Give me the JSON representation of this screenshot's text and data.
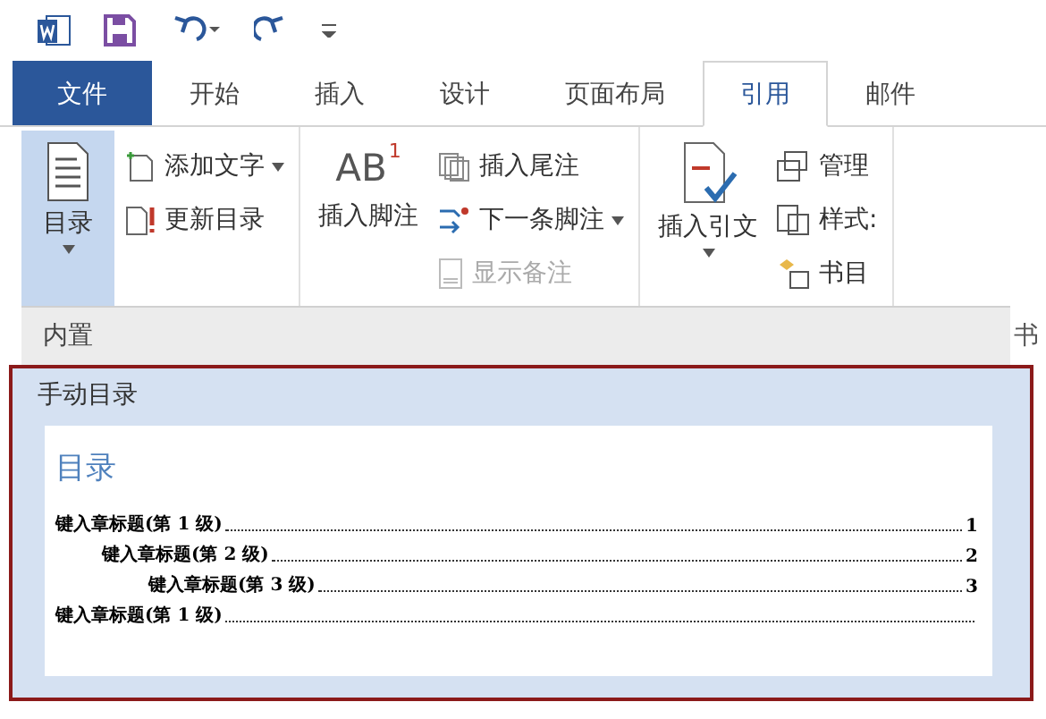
{
  "tabs": [
    {
      "label": "文件",
      "kind": "file",
      "selected": false
    },
    {
      "label": "开始",
      "kind": "tab",
      "selected": false
    },
    {
      "label": "插入",
      "kind": "tab",
      "selected": false
    },
    {
      "label": "设计",
      "kind": "tab",
      "selected": false
    },
    {
      "label": "页面布局",
      "kind": "tab",
      "selected": false
    },
    {
      "label": "引用",
      "kind": "tab",
      "selected": true
    },
    {
      "label": "邮件",
      "kind": "tab",
      "selected": false
    }
  ],
  "ribbon": {
    "groups": [
      {
        "big": {
          "label": "目录",
          "kind": "toc",
          "selected": true,
          "dropdown": true
        },
        "small": [
          {
            "label": "添加文字",
            "kind": "addtext",
            "dropdown": true,
            "disabled": false
          },
          {
            "label": "更新目录",
            "kind": "update",
            "dropdown": false,
            "disabled": false
          }
        ]
      },
      {
        "big": {
          "label": "插入脚注",
          "kind": "footnote",
          "glyph": "AB",
          "glyph_sup": "1",
          "selected": false,
          "dropdown": false
        },
        "small": [
          {
            "label": "插入尾注",
            "kind": "endnote",
            "dropdown": false,
            "disabled": false
          },
          {
            "label": "下一条脚注",
            "kind": "next",
            "dropdown": true,
            "disabled": false
          },
          {
            "label": "显示备注",
            "kind": "show",
            "dropdown": false,
            "disabled": true
          }
        ]
      },
      {
        "big": {
          "label": "插入引文",
          "kind": "citation",
          "selected": false,
          "dropdown": true
        },
        "small": [
          {
            "label": "管理",
            "kind": "manage",
            "dropdown": false,
            "disabled": false
          },
          {
            "label": "样式:",
            "kind": "style",
            "dropdown": false,
            "disabled": false
          },
          {
            "label": "书目",
            "kind": "biblio",
            "dropdown": false,
            "disabled": false
          }
        ]
      }
    ],
    "group_label_fragment": "书"
  },
  "dropdown": {
    "section": "内置",
    "item": {
      "title": "手动目录",
      "selected": true,
      "preview": {
        "heading": "目录",
        "entries": [
          {
            "text": "键入章标题(第 1 级)",
            "page": "1",
            "children": [
              {
                "text": "键入章标题(第 2 级)",
                "page": "2",
                "children": [
                  {
                    "text": "键入章标题(第 3 级)",
                    "page": "3"
                  }
                ]
              }
            ]
          },
          {
            "text": "键入章标题(第 1 级)"
          }
        ]
      }
    }
  }
}
